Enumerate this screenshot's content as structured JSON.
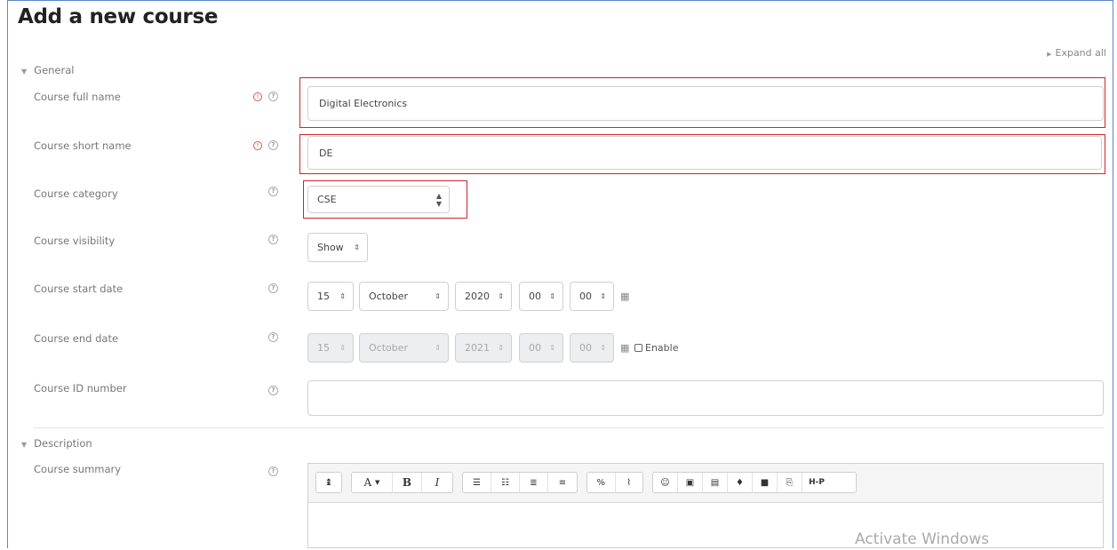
{
  "page": {
    "title": "Add a new course",
    "expand_all": "Expand all",
    "watermark": "Activate Windows"
  },
  "sections": {
    "general": "General",
    "description": "Description"
  },
  "fields": {
    "full_name": {
      "label": "Course full name",
      "value": "Digital Electronics",
      "required": true
    },
    "short_name": {
      "label": "Course short name",
      "value": "DE",
      "required": true
    },
    "category": {
      "label": "Course category",
      "value": "CSE"
    },
    "visibility": {
      "label": "Course visibility",
      "value": "Show"
    },
    "start_date": {
      "label": "Course start date",
      "day": "15",
      "month": "October",
      "year": "2020",
      "hour": "00",
      "minute": "00"
    },
    "end_date": {
      "label": "Course end date",
      "day": "15",
      "month": "October",
      "year": "2021",
      "hour": "00",
      "minute": "00",
      "enable_label": "Enable",
      "enabled": false
    },
    "id_number": {
      "label": "Course ID number",
      "value": ""
    },
    "summary": {
      "label": "Course summary"
    }
  },
  "icons": {
    "required": "exclamation-circle-icon",
    "help": "question-circle-icon",
    "calendar": "calendar-icon",
    "section_toggle": "caret-down-icon"
  },
  "toolbar": {
    "collapse": "↨",
    "font": "A",
    "bold": "B",
    "italic": "I",
    "h5p": "H-P"
  },
  "colors": {
    "highlight": "#c9262b",
    "frame": "#5b86c9",
    "required": "#d9534f"
  }
}
